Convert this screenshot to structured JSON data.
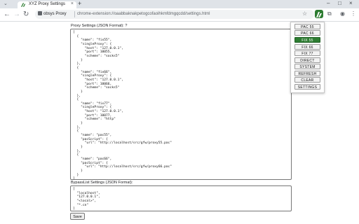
{
  "browser": {
    "tab_title": "XYZ Proxy Settings",
    "new_tab_icon": "plus-icon",
    "origin_chip": "obsys Proxy",
    "url": "chrome-extension://oaabbaknakpetogcofaoihkmfdmgqcdd/settings.html",
    "accent_color": "#2e7d32"
  },
  "proxy_settings": {
    "label": "Proxy Settings (JSON Format): ?",
    "json_text": "[\n  {\n    \"name\": \"fix55\",\n    \"singleProxy\": {\n      \"host\": \"127.0.0.1\",\n      \"port\": 10055,\n      \"scheme\": \"socks5\"\n    }\n  },\n  {\n    \"name\": \"fix66\",\n    \"singleProxy\": {\n      \"host\": \"127.0.0.1\",\n      \"port\": 10066,\n      \"scheme\": \"socks5\"\n    }\n  },\n  {\n    \"name\": \"fix77\",\n    \"singleProxy\": {\n      \"host\": \"127.0.0.1\",\n      \"port\": 10077,\n      \"scheme\": \"http\"\n    }\n  },\n  {\n    \"name\": \"pac55\",\n    \"pacScript\": {\n      \"url\": \"http://localhost/src/gfw/proxy55.pac\"\n    }\n  },\n  {\n    \"name\": \"pac66\",\n    \"pacScript\": {\n      \"url\": \"http://localhost/src/gfw/proxy66.pac\"\n    }\n  }\n]"
  },
  "bypass_settings": {
    "label": "BypassList Settings (JSON Format):",
    "json_text": "[\n  \"localhost\",\n  \"127.0.0.1\",\n  \"<local>\",\n  \"*.cn\"\n]"
  },
  "save_label": "Save",
  "popup": {
    "buttons": [
      {
        "label": "PAC 55",
        "active": false
      },
      {
        "label": "PAC 66",
        "active": false
      },
      {
        "label": "FIX 55",
        "active": true
      },
      {
        "label": "FIX 66",
        "active": false
      },
      {
        "label": "FIX 77",
        "active": false
      },
      {
        "label": "DIRECT",
        "active": false
      },
      {
        "label": "SYSTEM",
        "active": false
      },
      {
        "label": "REFRESH",
        "active": false
      },
      {
        "label": "CLEAR",
        "active": false
      },
      {
        "label": "SETTINGS",
        "active": false
      }
    ]
  }
}
